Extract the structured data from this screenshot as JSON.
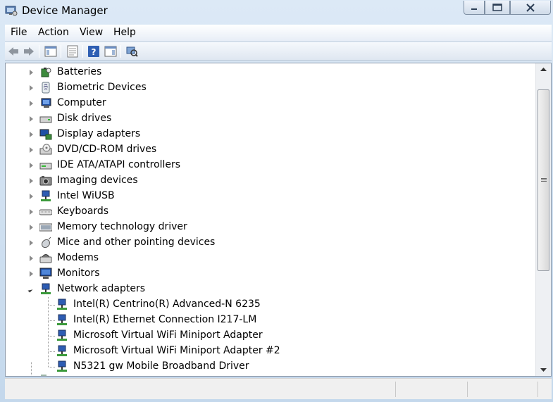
{
  "window": {
    "title": "Device Manager"
  },
  "menu": [
    "File",
    "Action",
    "View",
    "Help"
  ],
  "toolbar": [
    "back-icon",
    "forward-icon",
    "show-hide-tree-icon",
    "properties-icon",
    "help-icon",
    "action-pane-icon",
    "scan-hardware-icon"
  ],
  "tree": {
    "categories": [
      {
        "label": "Batteries",
        "icon": "battery-icon"
      },
      {
        "label": "Biometric Devices",
        "icon": "biometric-icon"
      },
      {
        "label": "Computer",
        "icon": "computer-icon"
      },
      {
        "label": "Disk drives",
        "icon": "disk-drive-icon"
      },
      {
        "label": "Display adapters",
        "icon": "display-adapter-icon"
      },
      {
        "label": "DVD/CD-ROM drives",
        "icon": "dvd-drive-icon"
      },
      {
        "label": "IDE ATA/ATAPI controllers",
        "icon": "ide-controller-icon"
      },
      {
        "label": "Imaging devices",
        "icon": "camera-icon"
      },
      {
        "label": "Intel WiUSB",
        "icon": "network-icon"
      },
      {
        "label": "Keyboards",
        "icon": "keyboard-icon"
      },
      {
        "label": "Memory technology driver",
        "icon": "memory-icon"
      },
      {
        "label": "Mice and other pointing devices",
        "icon": "mouse-icon"
      },
      {
        "label": "Modems",
        "icon": "modem-icon"
      },
      {
        "label": "Monitors",
        "icon": "monitor-icon"
      },
      {
        "label": "Network adapters",
        "icon": "network-icon",
        "expanded": true
      }
    ],
    "network_children": [
      "Intel(R) Centrino(R) Advanced-N 6235",
      "Intel(R) Ethernet Connection I217-LM",
      "Microsoft Virtual WiFi Miniport Adapter",
      "Microsoft Virtual WiFi Miniport Adapter #2",
      "N5321 gw Mobile Broadband Driver"
    ]
  }
}
